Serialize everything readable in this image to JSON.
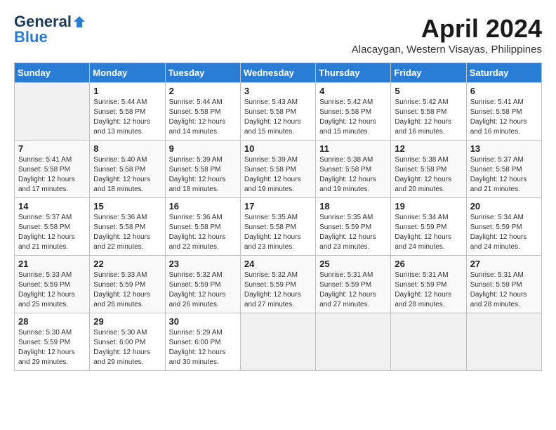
{
  "logo": {
    "general": "General",
    "blue": "Blue"
  },
  "title": "April 2024",
  "subtitle": "Alacaygan, Western Visayas, Philippines",
  "headers": [
    "Sunday",
    "Monday",
    "Tuesday",
    "Wednesday",
    "Thursday",
    "Friday",
    "Saturday"
  ],
  "weeks": [
    [
      {
        "day": "",
        "empty": true
      },
      {
        "day": "1",
        "sunrise": "5:44 AM",
        "sunset": "5:58 PM",
        "daylight": "12 hours and 13 minutes."
      },
      {
        "day": "2",
        "sunrise": "5:44 AM",
        "sunset": "5:58 PM",
        "daylight": "12 hours and 14 minutes."
      },
      {
        "day": "3",
        "sunrise": "5:43 AM",
        "sunset": "5:58 PM",
        "daylight": "12 hours and 15 minutes."
      },
      {
        "day": "4",
        "sunrise": "5:42 AM",
        "sunset": "5:58 PM",
        "daylight": "12 hours and 15 minutes."
      },
      {
        "day": "5",
        "sunrise": "5:42 AM",
        "sunset": "5:58 PM",
        "daylight": "12 hours and 16 minutes."
      },
      {
        "day": "6",
        "sunrise": "5:41 AM",
        "sunset": "5:58 PM",
        "daylight": "12 hours and 16 minutes."
      }
    ],
    [
      {
        "day": "7",
        "sunrise": "5:41 AM",
        "sunset": "5:58 PM",
        "daylight": "12 hours and 17 minutes."
      },
      {
        "day": "8",
        "sunrise": "5:40 AM",
        "sunset": "5:58 PM",
        "daylight": "12 hours and 18 minutes."
      },
      {
        "day": "9",
        "sunrise": "5:39 AM",
        "sunset": "5:58 PM",
        "daylight": "12 hours and 18 minutes."
      },
      {
        "day": "10",
        "sunrise": "5:39 AM",
        "sunset": "5:58 PM",
        "daylight": "12 hours and 19 minutes."
      },
      {
        "day": "11",
        "sunrise": "5:38 AM",
        "sunset": "5:58 PM",
        "daylight": "12 hours and 19 minutes."
      },
      {
        "day": "12",
        "sunrise": "5:38 AM",
        "sunset": "5:58 PM",
        "daylight": "12 hours and 20 minutes."
      },
      {
        "day": "13",
        "sunrise": "5:37 AM",
        "sunset": "5:58 PM",
        "daylight": "12 hours and 21 minutes."
      }
    ],
    [
      {
        "day": "14",
        "sunrise": "5:37 AM",
        "sunset": "5:58 PM",
        "daylight": "12 hours and 21 minutes."
      },
      {
        "day": "15",
        "sunrise": "5:36 AM",
        "sunset": "5:58 PM",
        "daylight": "12 hours and 22 minutes."
      },
      {
        "day": "16",
        "sunrise": "5:36 AM",
        "sunset": "5:58 PM",
        "daylight": "12 hours and 22 minutes."
      },
      {
        "day": "17",
        "sunrise": "5:35 AM",
        "sunset": "5:58 PM",
        "daylight": "12 hours and 23 minutes."
      },
      {
        "day": "18",
        "sunrise": "5:35 AM",
        "sunset": "5:59 PM",
        "daylight": "12 hours and 23 minutes."
      },
      {
        "day": "19",
        "sunrise": "5:34 AM",
        "sunset": "5:59 PM",
        "daylight": "12 hours and 24 minutes."
      },
      {
        "day": "20",
        "sunrise": "5:34 AM",
        "sunset": "5:59 PM",
        "daylight": "12 hours and 24 minutes."
      }
    ],
    [
      {
        "day": "21",
        "sunrise": "5:33 AM",
        "sunset": "5:59 PM",
        "daylight": "12 hours and 25 minutes."
      },
      {
        "day": "22",
        "sunrise": "5:33 AM",
        "sunset": "5:59 PM",
        "daylight": "12 hours and 26 minutes."
      },
      {
        "day": "23",
        "sunrise": "5:32 AM",
        "sunset": "5:59 PM",
        "daylight": "12 hours and 26 minutes."
      },
      {
        "day": "24",
        "sunrise": "5:32 AM",
        "sunset": "5:59 PM",
        "daylight": "12 hours and 27 minutes."
      },
      {
        "day": "25",
        "sunrise": "5:31 AM",
        "sunset": "5:59 PM",
        "daylight": "12 hours and 27 minutes."
      },
      {
        "day": "26",
        "sunrise": "5:31 AM",
        "sunset": "5:59 PM",
        "daylight": "12 hours and 28 minutes."
      },
      {
        "day": "27",
        "sunrise": "5:31 AM",
        "sunset": "5:59 PM",
        "daylight": "12 hours and 28 minutes."
      }
    ],
    [
      {
        "day": "28",
        "sunrise": "5:30 AM",
        "sunset": "5:59 PM",
        "daylight": "12 hours and 29 minutes."
      },
      {
        "day": "29",
        "sunrise": "5:30 AM",
        "sunset": "6:00 PM",
        "daylight": "12 hours and 29 minutes."
      },
      {
        "day": "30",
        "sunrise": "5:29 AM",
        "sunset": "6:00 PM",
        "daylight": "12 hours and 30 minutes."
      },
      {
        "day": "",
        "empty": true
      },
      {
        "day": "",
        "empty": true
      },
      {
        "day": "",
        "empty": true
      },
      {
        "day": "",
        "empty": true
      }
    ]
  ]
}
